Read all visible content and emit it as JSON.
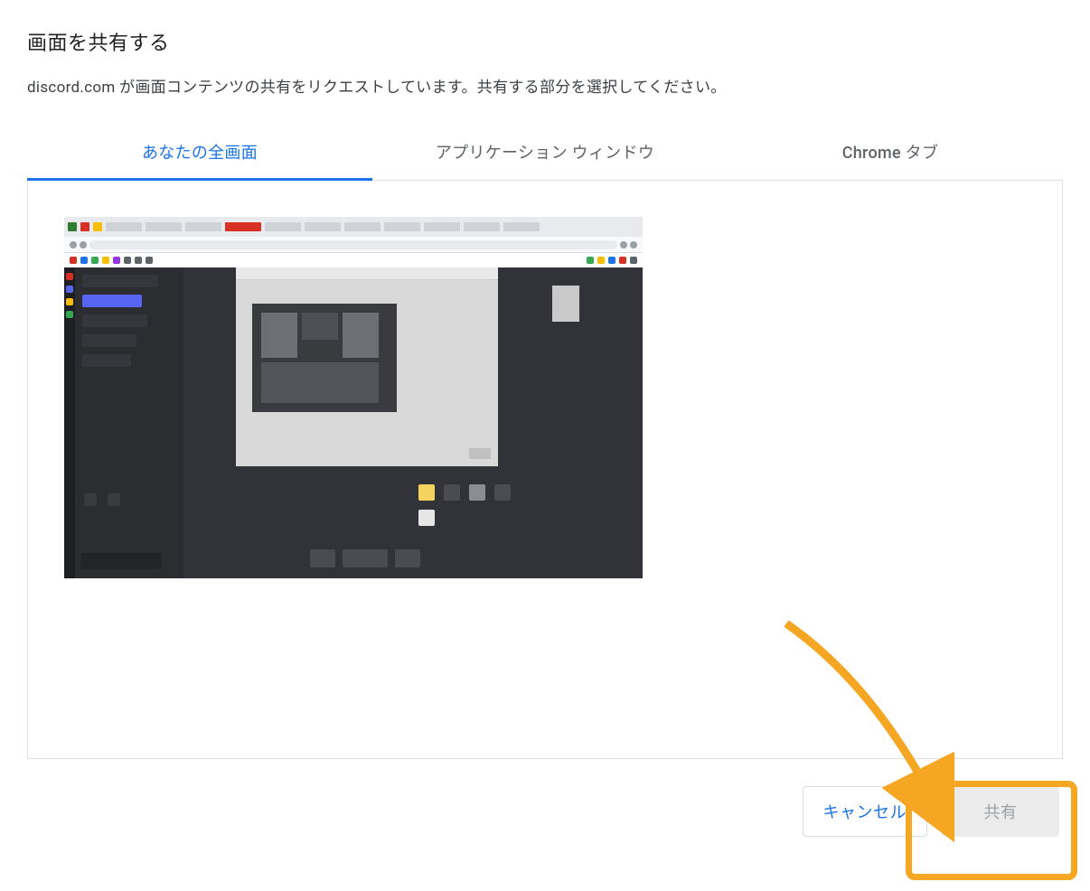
{
  "dialog": {
    "title": "画面を共有する",
    "subtitle": "discord.com が画面コンテンツの共有をリクエストしています。共有する部分を選択してください。"
  },
  "tabs": {
    "entire_screen": "あなたの全画面",
    "app_window": "アプリケーション ウィンドウ",
    "chrome_tab": "Chrome タブ"
  },
  "buttons": {
    "cancel": "キャンセル",
    "share": "共有"
  },
  "colors": {
    "accent": "#1a73e8",
    "annotation": "#f5a623"
  }
}
